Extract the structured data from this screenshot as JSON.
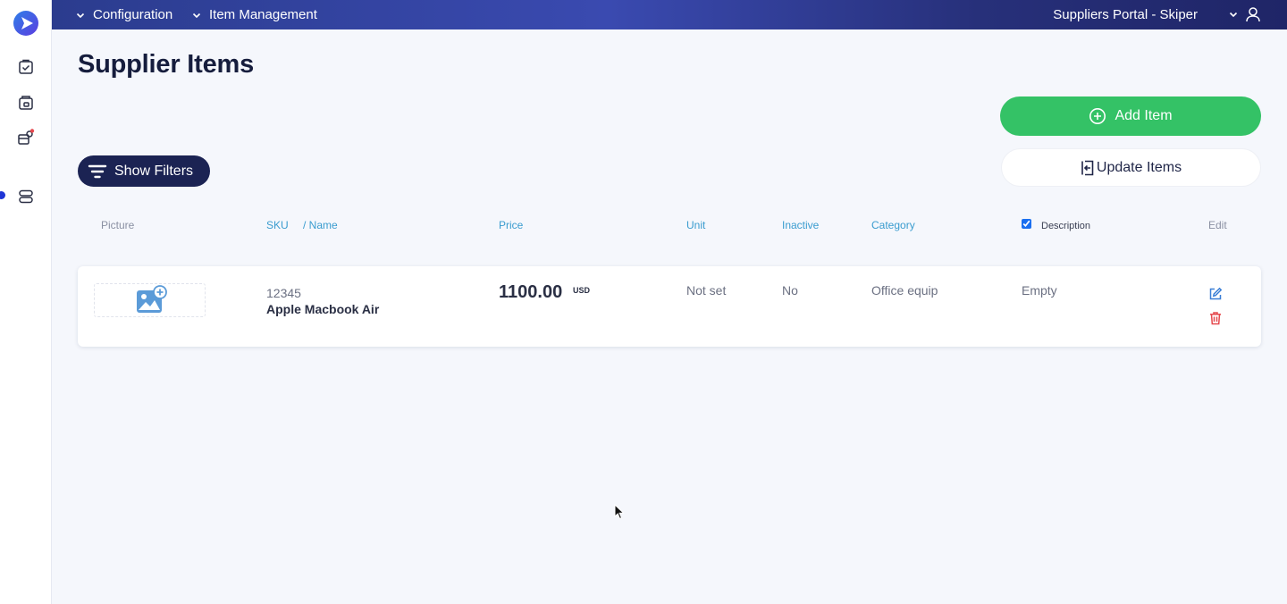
{
  "topbar": {
    "crumb1": "Configuration",
    "crumb2": "Item Management",
    "portal": "Suppliers Portal - Skiper"
  },
  "page": {
    "title": "Supplier Items"
  },
  "actions": {
    "add_item": "Add Item",
    "update_items": "Update Items",
    "show_filters": "Show Filters"
  },
  "table": {
    "headers": {
      "picture": "Picture",
      "sku": "SKU",
      "name": "/ Name",
      "price": "Price",
      "unit": "Unit",
      "inactive": "Inactive",
      "category": "Category",
      "description": "Description",
      "edit": "Edit"
    },
    "description_checked": true,
    "rows": [
      {
        "sku": "12345",
        "name": "Apple Macbook Air",
        "price": "1100.00",
        "currency": "USD",
        "unit": "Not set",
        "inactive": "No",
        "category": "Office equip",
        "description": "Empty"
      }
    ]
  },
  "colors": {
    "accent_green": "#34c266",
    "nav_dark": "#1b2353",
    "header_link": "#3a9ccf",
    "delete_red": "#e5484d",
    "edit_blue": "#3b7fd6"
  },
  "icons": [
    "logo-icon",
    "checklist-icon",
    "store-icon",
    "supplier-icon",
    "toggle-icon",
    "chevron-down-icon",
    "user-icon",
    "plus-circle-icon",
    "import-icon",
    "filter-icon",
    "add-image-icon",
    "edit-icon",
    "delete-icon"
  ]
}
